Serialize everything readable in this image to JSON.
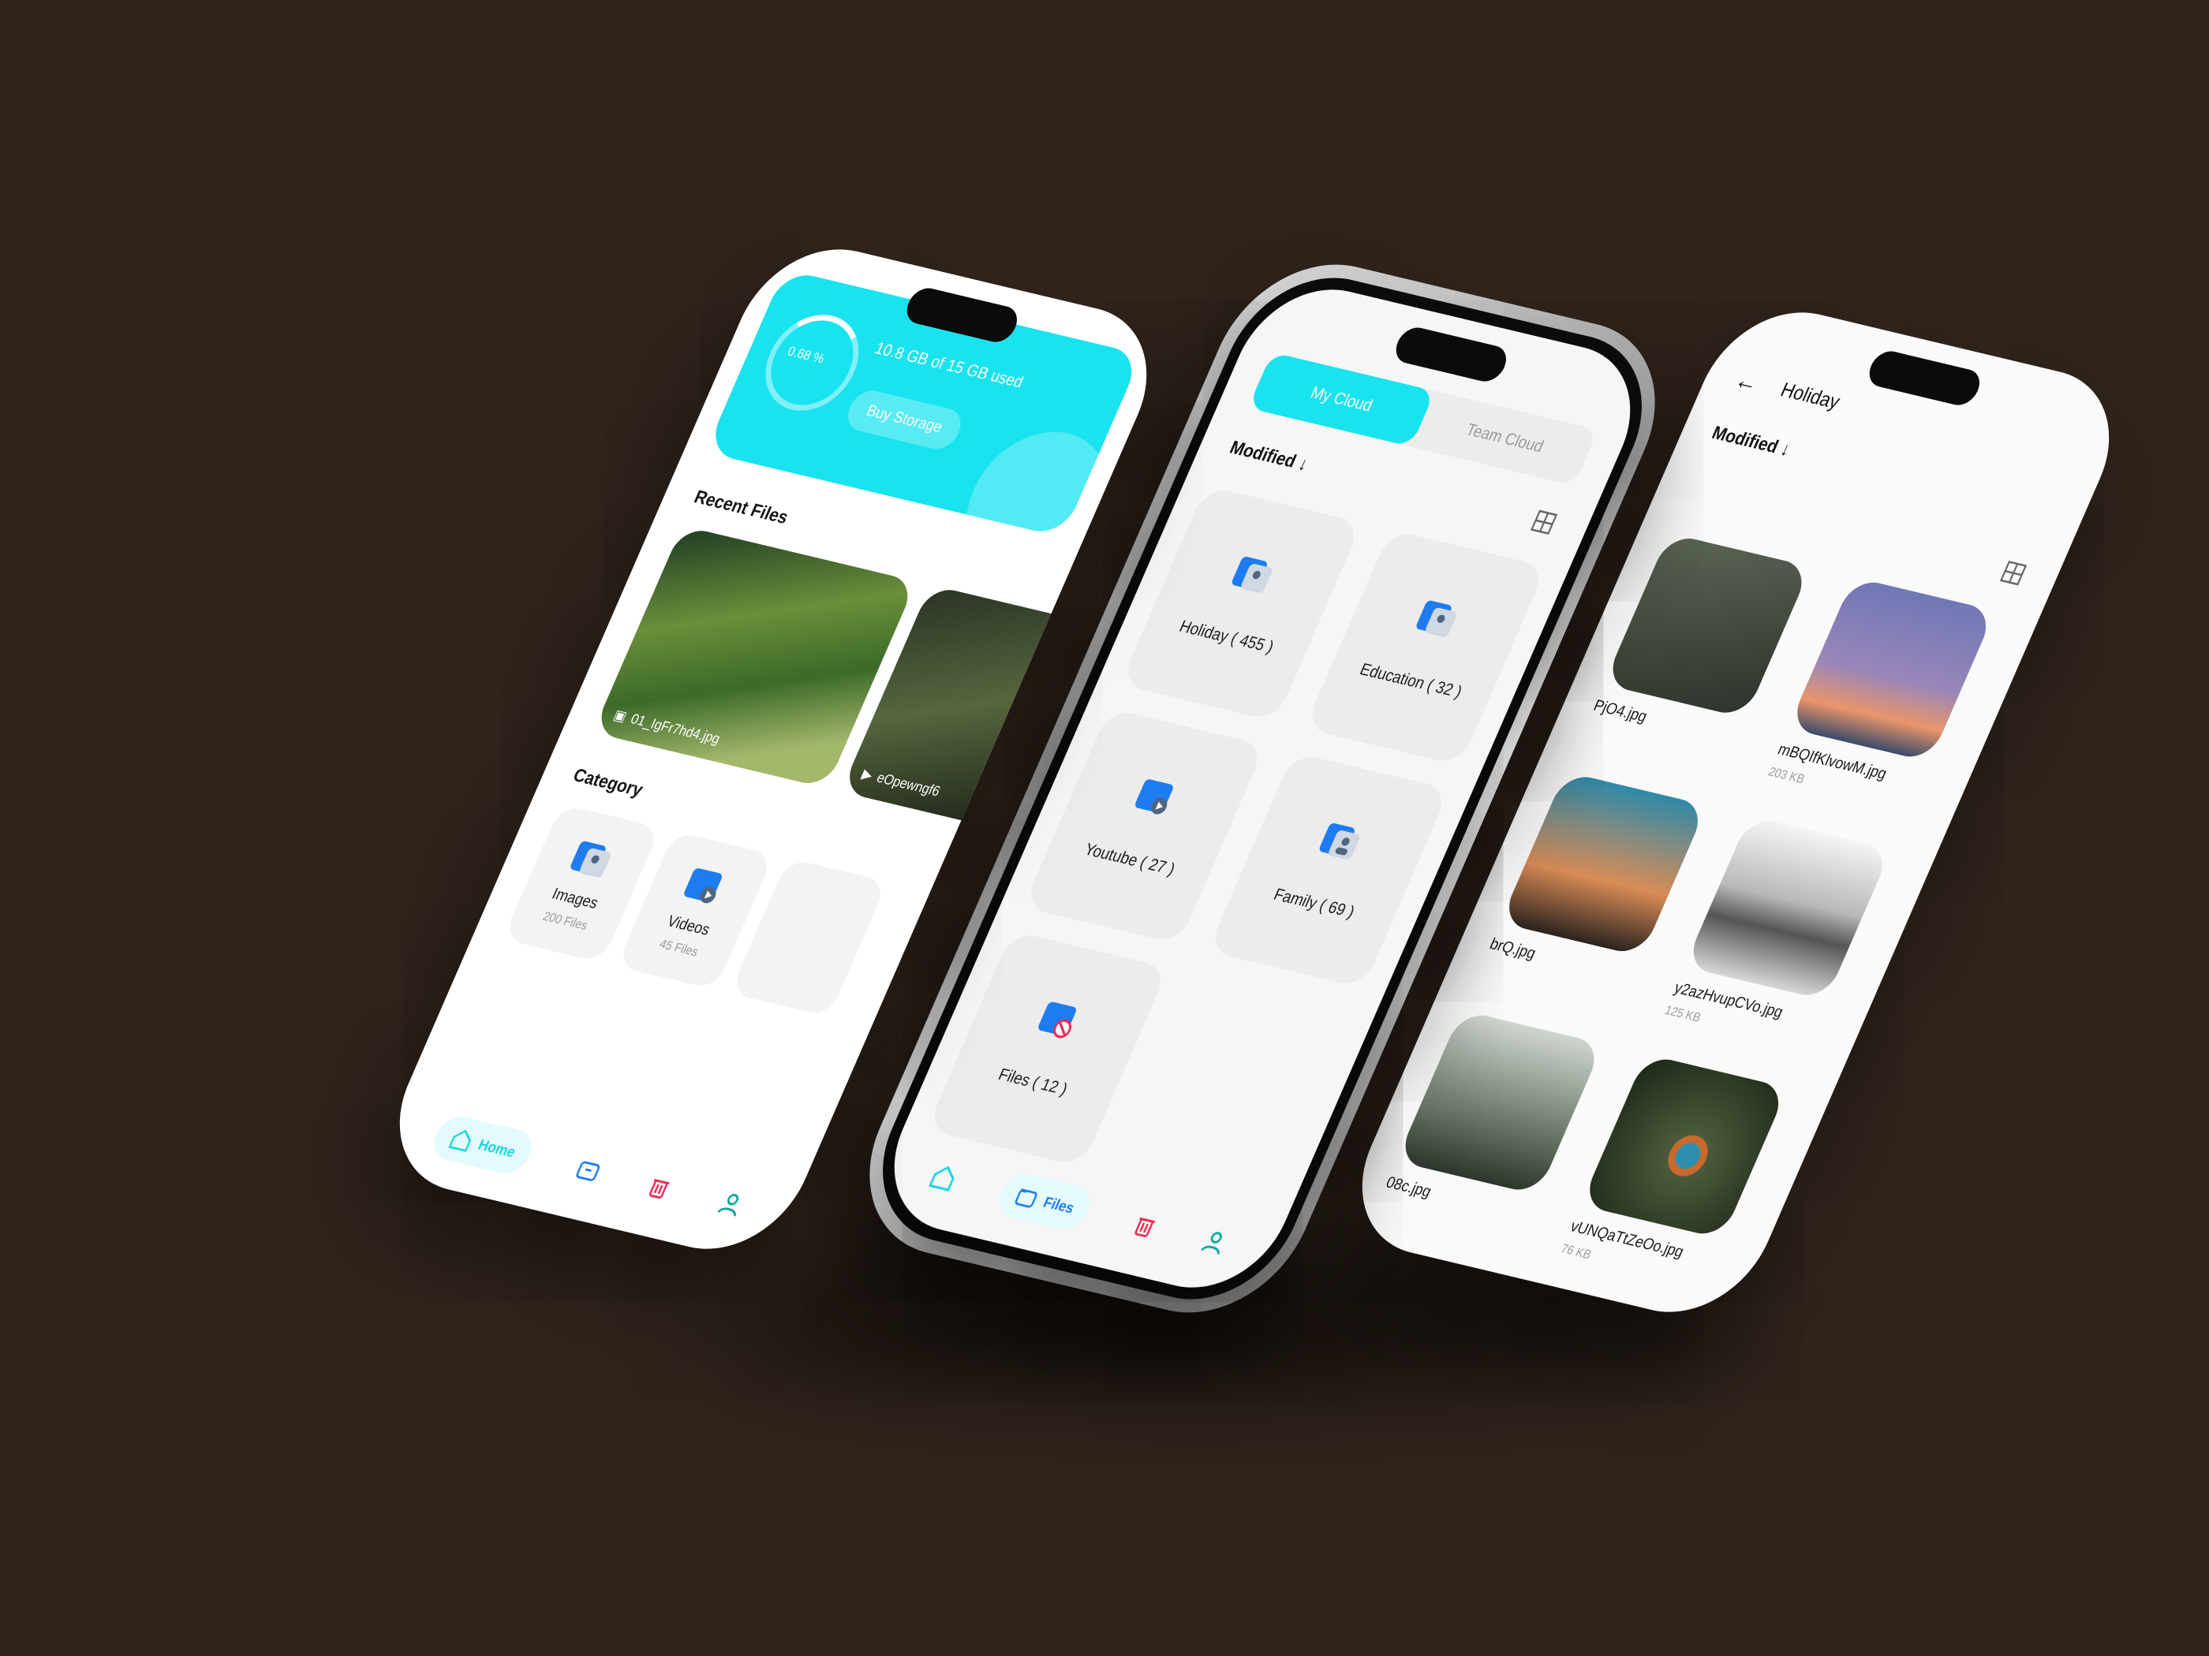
{
  "colors": {
    "background": "#30241c",
    "accent_cyan": "#19e3ef",
    "folder_blue": "#1e7cf0",
    "trash_red": "#ef2b55",
    "profile_teal": "#13a99a"
  },
  "left_phone": {
    "storage": {
      "percent_label": "0.68 %",
      "usage_text": "10.8 GB of 15 GB used",
      "buy_button": "Buy Storage"
    },
    "recent_files_title": "Recent Files",
    "recent_files": [
      {
        "name": "01_IgFr7hd4.jpg",
        "type_icon": "image-icon"
      },
      {
        "name": "eOpewngf6",
        "type_icon": "video-icon"
      }
    ],
    "category_title": "Category",
    "categories": [
      {
        "name": "Images",
        "count": "200 Files",
        "icon": "image-folder-icon"
      },
      {
        "name": "Videos",
        "count": "45 Files",
        "icon": "video-folder-icon"
      }
    ],
    "nav": {
      "home_label": "Home",
      "home_icon": "home-icon",
      "files_icon": "folder-icon",
      "trash_icon": "trash-icon",
      "profile_icon": "profile-icon"
    }
  },
  "middle_phone": {
    "tabs": [
      "My Cloud",
      "Team Cloud"
    ],
    "sort_label": "Modified ↓",
    "folders": [
      {
        "name": "Holiday ( 455 )"
      },
      {
        "name": "Education ( 32 )"
      },
      {
        "name": "Youtube ( 27 )"
      },
      {
        "name": "Family ( 69 )"
      },
      {
        "name": "Files ( 12 )"
      }
    ],
    "nav": {
      "files_label": "Files"
    }
  },
  "right_phone": {
    "title": "Holiday",
    "sort_label": "Modified ↓",
    "photos": [
      {
        "name": "PjO4.jpg",
        "size": ""
      },
      {
        "name": "mBQIfKlvowM.jpg",
        "size": "203 KB"
      },
      {
        "name": "brQ.jpg",
        "size": ""
      },
      {
        "name": "y2azHvupCVo.jpg",
        "size": "125 KB"
      },
      {
        "name": "08c.jpg",
        "size": ""
      },
      {
        "name": "vUNQaTtZeOo.jpg",
        "size": "76 KB"
      }
    ]
  }
}
